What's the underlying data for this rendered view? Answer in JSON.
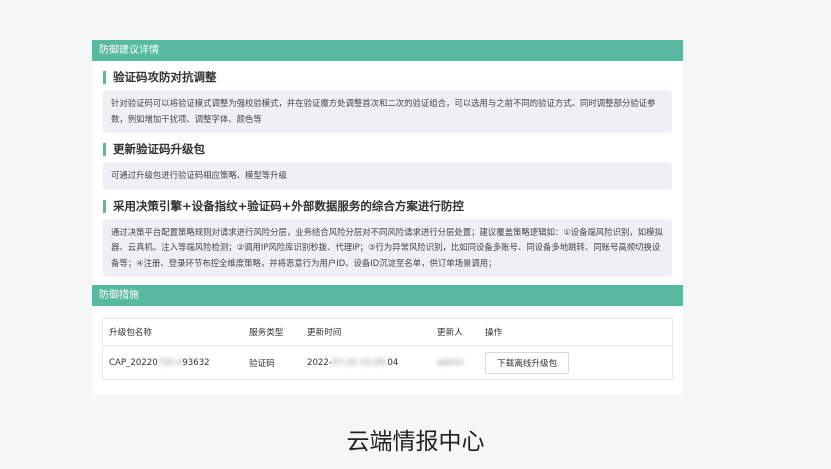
{
  "advice": {
    "header": "防御建议详情",
    "sections": [
      {
        "title": "验证码攻防对抗调整",
        "body": "针对验证码可以将验证模式调整为强校验模式，并在验证魔方处调整首次和二次的验证组合，可以选用与之前不同的验证方式。同时调整部分验证参数，例如增加干扰项、调整字体、颜色等"
      },
      {
        "title": "更新验证码升级包",
        "body": "可通过升级包进行验证码相应策略、模型等升级"
      },
      {
        "title": "采用决策引擎+设备指纹+验证码+外部数据服务的综合方案进行防控",
        "body": "通过决策平台配置策略规则对请求进行风险分层，业务结合风险分层对不同风险请求进行分层处置；建议覆盖策略逻辑如：①设备端风险识别，如模拟器、云真机、注入等端风险检测；②调用IP风险库识别秒拨、代理IP；③行为异常风险识别，比如同设备多账号、同设备多地跳转、同账号高频切换设备等；④注册、登录环节布控全维度策略，并将恶意行为用户ID、设备ID沉淀至名单，供订单场景调用；"
      }
    ]
  },
  "measures": {
    "header": "防御措施",
    "columns": [
      "升级包名称",
      "服务类型",
      "更新时间",
      "更新人",
      "操作"
    ],
    "row": {
      "name_prefix": "CAP_20220",
      "name_blur": "720.4",
      "name_suffix": "93632",
      "type": "验证码",
      "time_prefix": "2022-",
      "time_blur": "07-20 10:28:",
      "time_suffix": "04",
      "updater_blur": "admin",
      "action": "下载离线升级包"
    }
  },
  "caption": "云端情报中心"
}
